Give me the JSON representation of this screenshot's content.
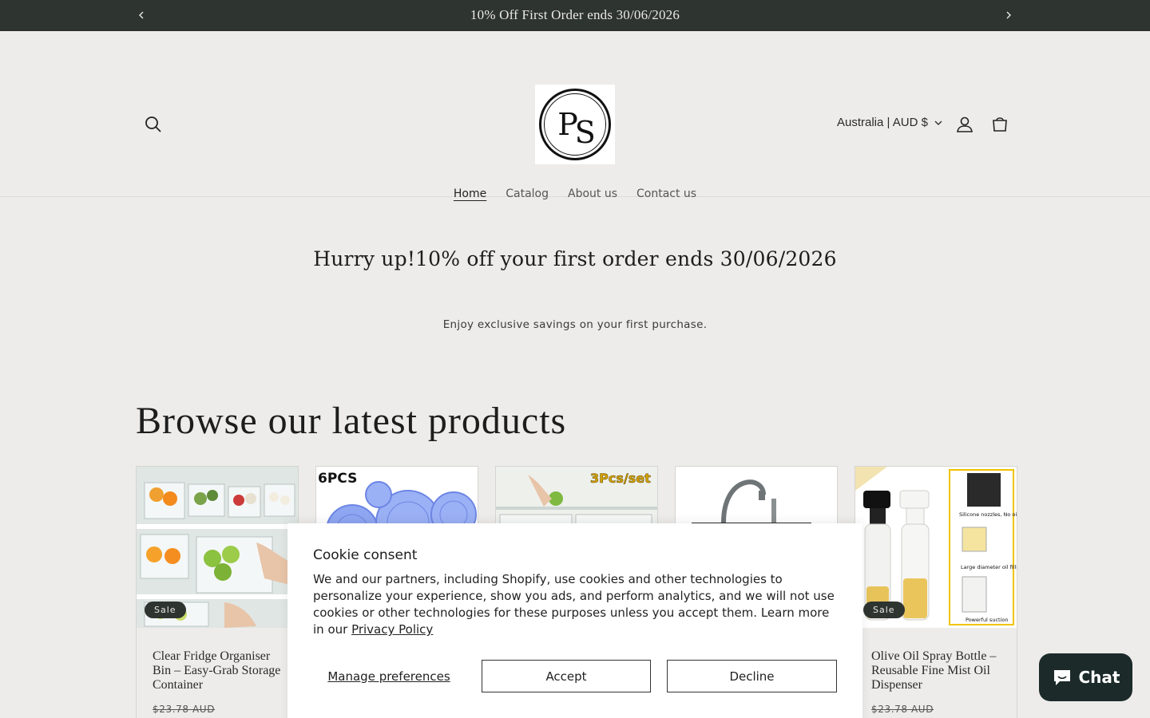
{
  "announcement": {
    "text": "10% Off First Order ends 30/06/2026",
    "prev_icon": "chevron-left-icon",
    "next_icon": "chevron-right-icon"
  },
  "header": {
    "logo_monogram_left": "P",
    "logo_monogram_right": "S",
    "country_selector": "Australia | AUD $",
    "icons": [
      "search-icon",
      "account-icon",
      "cart-icon"
    ]
  },
  "nav": {
    "items": [
      {
        "label": "Home",
        "active": true
      },
      {
        "label": "Catalog",
        "active": false
      },
      {
        "label": "About us",
        "active": false
      },
      {
        "label": "Contact us",
        "active": false
      }
    ]
  },
  "promo": {
    "title": "Hurry up!10% off your first order ends 30/06/2026",
    "subtitle": "Enjoy exclusive savings on your first purchase."
  },
  "products_section": {
    "title": "Browse our latest products",
    "products": [
      {
        "title": "Clear Fridge Organiser Bin – Easy-Grab Storage Container",
        "badge": "Sale",
        "price": "$23.78 AUD",
        "image_caption": ""
      },
      {
        "title": "",
        "badge": "",
        "price": "",
        "image_caption": "6PCS"
      },
      {
        "title": "",
        "badge": "",
        "price": "",
        "image_caption": "3Pcs/set"
      },
      {
        "title": "",
        "badge": "",
        "price": "",
        "image_caption": ""
      },
      {
        "title": "Olive Oil Spray Bottle – Reusable Fine Mist Oil Dispenser",
        "badge": "Sale",
        "price": "$23.78 AUD",
        "image_caption": ""
      }
    ],
    "product5_callouts": [
      "Silicone nozzles, No oil dripping",
      "Large diameter oil filling port",
      "Powerful suction"
    ]
  },
  "cookie": {
    "title": "Cookie consent",
    "body": "We and our partners, including Shopify, use cookies and other technologies to personalize your experience, show you ads, and perform analytics, and we will not use cookies or other technologies for these purposes unless you accept them. Learn more in our ",
    "policy_link": "Privacy Policy",
    "manage": "Manage preferences",
    "accept": "Accept",
    "decline": "Decline"
  },
  "chat": {
    "label": "Chat",
    "icon": "chat-bubble-icon"
  },
  "colors": {
    "announcement_bg": "#2e3430",
    "page_bg": "#edecea",
    "chat_bg": "#1c2a2a"
  }
}
